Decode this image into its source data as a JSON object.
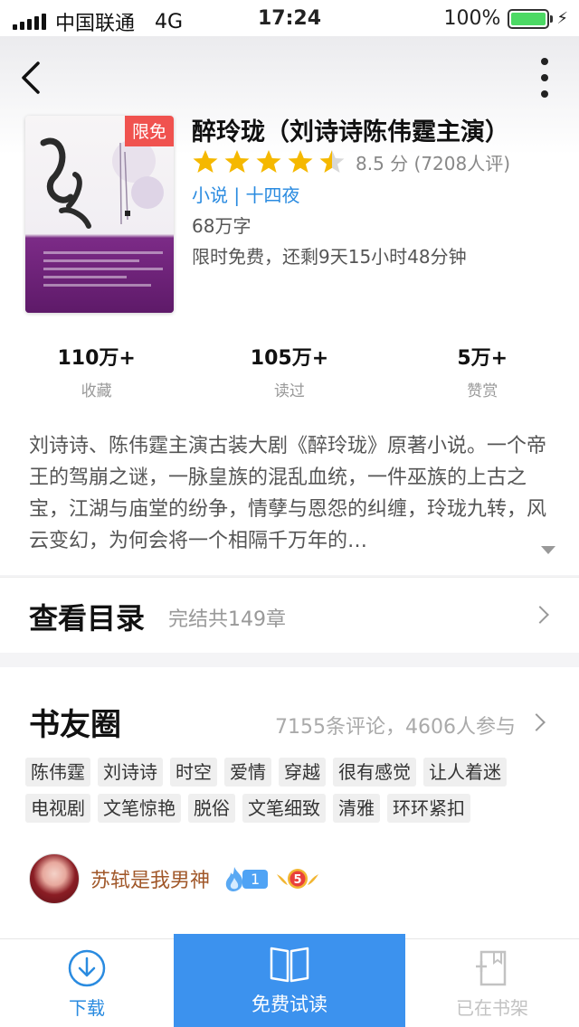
{
  "status_bar": {
    "carrier": "中国联通",
    "network": "4G",
    "time": "17:24",
    "battery": "100%"
  },
  "book": {
    "title": "醉玲珑（刘诗诗陈伟霆主演）",
    "free_badge": "限免",
    "rating_value": 4.5,
    "rating_max": 5,
    "rating_text": "8.5 分 (7208人评)",
    "category": "小说 | 十四夜",
    "word_count": "68万字",
    "free_timer": "限时免费，还剩9天15小时48分钟"
  },
  "stats": [
    {
      "value": "110万+",
      "label": "收藏"
    },
    {
      "value": "105万+",
      "label": "读过"
    },
    {
      "value": "5万+",
      "label": "赞赏"
    }
  ],
  "description": "刘诗诗、陈伟霆主演古装大剧《醉玲珑》原著小说。一个帝王的驾崩之谜，一脉皇族的混乱血统，一件巫族的上古之宝，江湖与庙堂的纷争，情孽与恩怨的纠缠，玲珑九转，风云变幻，为何会将一个相隔千万年的…",
  "catalog": {
    "title": "查看目录",
    "subtitle": "完结共149章"
  },
  "circle": {
    "title": "书友圈",
    "stats": "7155条评论，4606人参与",
    "tags": [
      "陈伟霆",
      "刘诗诗",
      "时空",
      "爱情",
      "穿越",
      "很有感觉",
      "让人着迷",
      "电视剧",
      "文笔惊艳",
      "脱俗",
      "文笔细致",
      "清雅",
      "环环紧扣"
    ],
    "commenter": {
      "name": "苏轼是我男神",
      "fire_level": "1",
      "vip_level": "5"
    }
  },
  "bottom_bar": {
    "download": "下载",
    "read": "免费试读",
    "shelf": "已在书架"
  },
  "colors": {
    "accent": "#2a8be0",
    "read_button": "#3c92ee",
    "badge": "#f0524f",
    "star": "#f5b800",
    "star_empty": "#d8d8d8"
  }
}
